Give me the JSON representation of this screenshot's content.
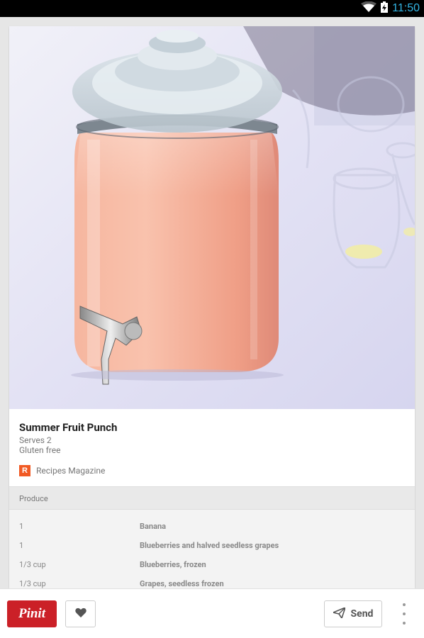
{
  "status_bar": {
    "time": "11:50",
    "icons": [
      "wifi-icon",
      "battery-charging-icon"
    ],
    "time_color": "#33b5e5"
  },
  "pin": {
    "image": "glass-drink-dispenser-photo",
    "title": "Summer Fruit Punch",
    "serves": "Serves 2",
    "diet": "Gluten free",
    "source": {
      "logo_letter": "R",
      "logo_color": "#f15a24",
      "name": "Recipes Magazine"
    }
  },
  "ingredients": {
    "section": "Produce",
    "rows": [
      {
        "qty": "1",
        "name": "Banana"
      },
      {
        "qty": "1",
        "name": "Blueberries and halved seedless grapes"
      },
      {
        "qty": "1/3 cup",
        "name": "Blueberries, frozen"
      },
      {
        "qty": "1/3 cup",
        "name": "Grapes, seedless frozen"
      }
    ]
  },
  "actions": {
    "pinit_label": "Pinit",
    "pinit_color": "#cb2027",
    "like_icon": "heart-icon",
    "send_label": "Send",
    "send_icon": "send-icon",
    "more_icon": "overflow-menu-icon"
  }
}
